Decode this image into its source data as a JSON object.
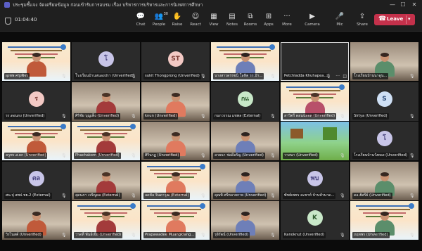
{
  "window": {
    "title": "ประชุมชี้แจง จัดเตรียมข้อมูล ก่อนเข้ารับการอบรม เรื่อง บริหารการบริหารและการนิเทศการศึกษา",
    "minimize_glyph": "—",
    "maximize_glyph": "☐",
    "close_glyph": "✕"
  },
  "toolbar": {
    "timer": "01:04:40",
    "buttons": [
      {
        "label": "Chat",
        "icon": "chat-icon",
        "glyph": "💬"
      },
      {
        "label": "People",
        "icon": "people-icon",
        "glyph": "👥",
        "badge": "30"
      },
      {
        "label": "Raise",
        "icon": "raise-hand-icon",
        "glyph": "✋"
      },
      {
        "label": "React",
        "icon": "react-icon",
        "glyph": "☺"
      },
      {
        "label": "View",
        "icon": "view-icon",
        "glyph": "▦"
      },
      {
        "label": "Notes",
        "icon": "notes-icon",
        "glyph": "▤"
      },
      {
        "label": "Rooms",
        "icon": "rooms-icon",
        "glyph": "⧉"
      },
      {
        "label": "Apps",
        "icon": "apps-icon",
        "glyph": "⊞"
      },
      {
        "label": "More",
        "icon": "more-icon",
        "glyph": "···"
      },
      {
        "label": "Camera",
        "icon": "camera-icon",
        "glyph": "▶"
      },
      {
        "label": "Mic",
        "icon": "mic-icon",
        "glyph": "🎤"
      },
      {
        "label": "Share",
        "icon": "share-icon",
        "glyph": "⇪"
      }
    ],
    "leave_label": "Leave",
    "leave_color": "#c4314b"
  },
  "participants": [
    {
      "name": "ผุงทพ ศรุ่งพิจร",
      "kind": "video-slide"
    },
    {
      "name": "โรงเรียนบ้านหนองปรา (Unverified)",
      "kind": "avatar",
      "initials": "โ",
      "avatar_color": "lavender"
    },
    {
      "name": "sukit Thongprong (Unverified)",
      "kind": "avatar",
      "initials": "ST",
      "avatar_color": "pink"
    },
    {
      "name": "นางสาวดรรชนี โลหิต รร.บ้า...",
      "kind": "video-slide"
    },
    {
      "name": "Petchladda Khuhapea...",
      "kind": "dark",
      "highlighted": true
    },
    {
      "name": "โรงเรียนบ้านนาดูน...",
      "kind": "video-person"
    },
    {
      "name": "รร.ดอนกง (Unverified)",
      "kind": "avatar",
      "initials": "ร",
      "avatar_color": "pink"
    },
    {
      "name": "ศิริชัย บุญเพ็ง (Unverified)",
      "kind": "video-person"
    },
    {
      "name": "knun (Unverified)",
      "kind": "video-person"
    },
    {
      "name": "กนกวรรณ แขพล (External)",
      "kind": "avatar",
      "initials": "กแ",
      "avatar_color": "mint"
    },
    {
      "name": "สาวิตรี ดอนปลอด (Unverified)",
      "kind": "video-slide"
    },
    {
      "name": "Sirtya (Unverified)",
      "kind": "avatar",
      "initials": "S",
      "avatar_color": "blue"
    },
    {
      "name": "ครูพร.ส.ยก (Unverified)",
      "kind": "video-slide"
    },
    {
      "name": "Phachakorn (Unverified)",
      "kind": "video-slide"
    },
    {
      "name": "ศิรินาฏ (Unverified)",
      "kind": "video-person"
    },
    {
      "name": "ลายนา ช่อดีอรัญ (Unverified)",
      "kind": "video-person"
    },
    {
      "name": "วาสนา (Unverified)",
      "kind": "video-green"
    },
    {
      "name": "โรงเรียนบ้านวังทอง (Unverified)",
      "kind": "avatar",
      "initials": "โ",
      "avatar_color": "lavender"
    },
    {
      "name": "ศน.ปุ สพป.ชย.2 (External)",
      "kind": "avatar",
      "initials": "ตล",
      "avatar_color": "lavender"
    },
    {
      "name": "สุดนภา เจริญผล (External)",
      "kind": "video-person"
    },
    {
      "name": "ลดหัล จินดาวุฒ (External)",
      "kind": "video-slide"
    },
    {
      "name": "คุณทิ ศรีหลายกาย (Unverified)",
      "kind": "video-person"
    },
    {
      "name": "พัชย์เพชร สะซาท์ บ้านหัวนาด...",
      "kind": "avatar",
      "initials": "พบ",
      "avatar_color": "lavender"
    },
    {
      "name": "ดอ.ฮัสรีย์ (Unverified)",
      "kind": "video-person"
    },
    {
      "name": "วิรไนสต์ (Unverified)",
      "kind": "video-person"
    },
    {
      "name": "วาดที่ พันธ์เขีย (Unverified)",
      "kind": "video-slide"
    },
    {
      "name": "Prapawadee Muangklang...",
      "kind": "video-slide"
    },
    {
      "name": "รุจิรัตน์ (Unverified)",
      "kind": "video-person"
    },
    {
      "name": "Kanoknut (Unverified)",
      "kind": "avatar",
      "initials": "K",
      "avatar_color": "mint"
    },
    {
      "name": "ภฤหพร (Unverified)",
      "kind": "video-slide"
    }
  ]
}
